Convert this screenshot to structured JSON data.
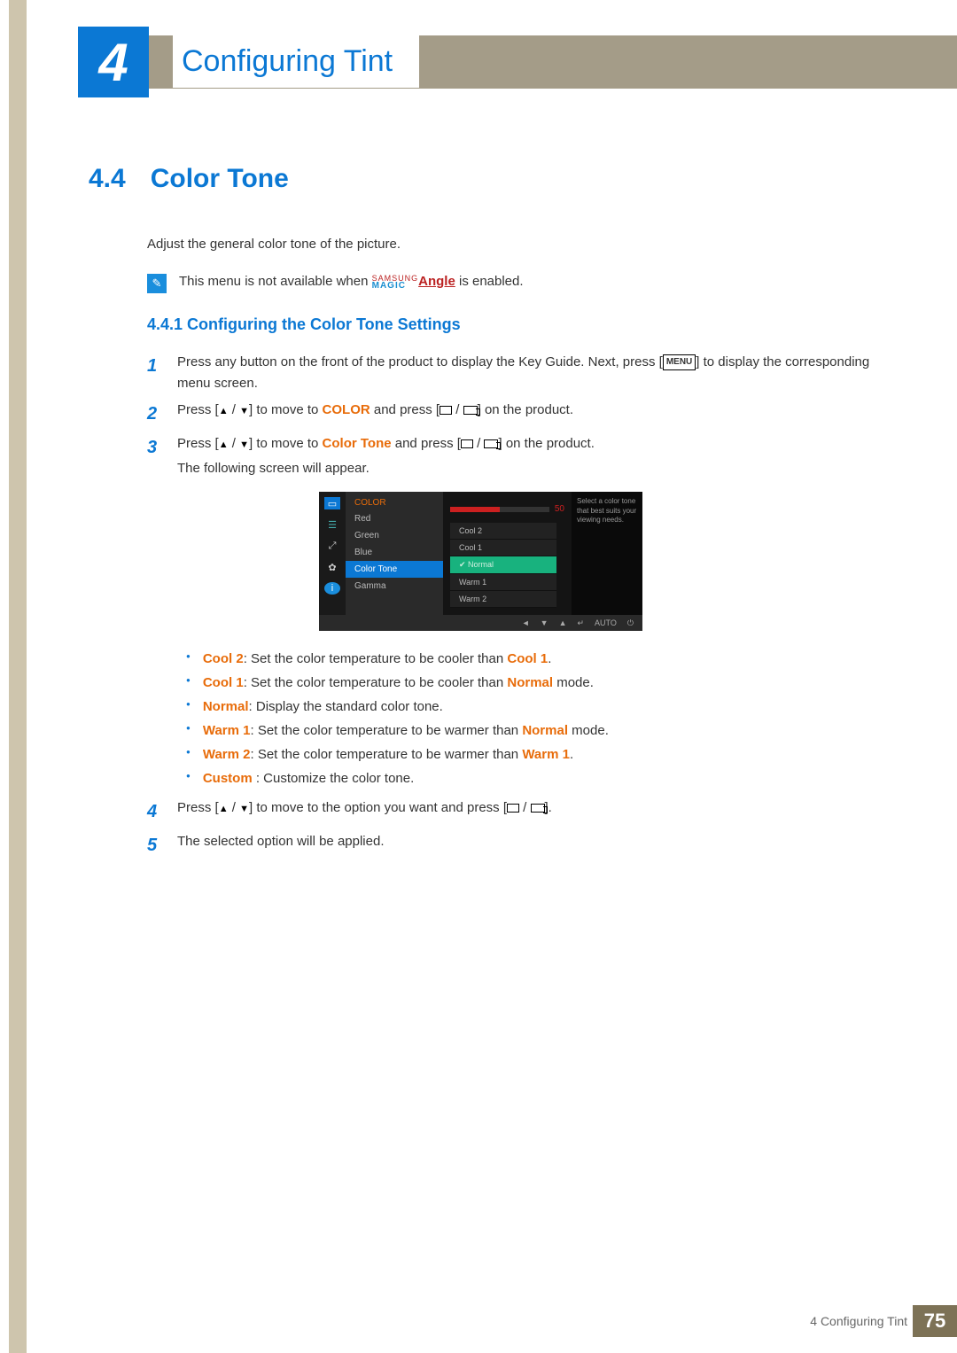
{
  "chapter": {
    "number": "4",
    "title": "Configuring Tint"
  },
  "section": {
    "number": "4.4",
    "title": "Color Tone"
  },
  "intro": "Adjust the general color tone of the picture.",
  "note": {
    "prefix": "This menu is not available when ",
    "brand_top": "SAMSUNG",
    "brand_bot": "MAGIC",
    "brand_word": "Angle",
    "suffix": " is enabled."
  },
  "subsection": "4.4.1   Configuring the Color Tone Settings",
  "steps": {
    "s1": "Press any button on the front of the product to display the Key Guide. Next, press [",
    "s1b": "] to display the corresponding menu screen.",
    "menu_label": "MENU",
    "s2a": "Press [",
    "s2b": "] to move to ",
    "s2c": " and press [",
    "s2d": "] on the product.",
    "color_kw": "COLOR",
    "s3a": "Press [",
    "s3b": "] to move to ",
    "s3c": " and press [",
    "s3d": "] on the product.",
    "ct_kw": "Color Tone",
    "s3e": "The following screen will appear.",
    "s4a": "Press [",
    "s4b": "] to move to the option you want and press [",
    "s4c": "].",
    "s5": "The selected option will be applied."
  },
  "osd": {
    "head": "COLOR",
    "items": [
      "Red",
      "Green",
      "Blue",
      "Color Tone",
      "Gamma"
    ],
    "slider_val": "50",
    "drop": [
      "Cool 2",
      "Cool 1",
      "Normal",
      "Warm 1",
      "Warm 2"
    ],
    "help": "Select a color tone that best suits your viewing needs.",
    "foot_auto": "AUTO"
  },
  "bullets": [
    {
      "k": "Cool 2",
      "t": ": Set the color temperature to be cooler than ",
      "r": "Cool 1",
      "end": "."
    },
    {
      "k": "Cool 1",
      "t": ": Set the color temperature to be cooler than ",
      "r": "Normal",
      "end": " mode."
    },
    {
      "k": "Normal",
      "t": ": Display the standard color tone.",
      "r": "",
      "end": ""
    },
    {
      "k": "Warm 1",
      "t": ": Set the color temperature to be warmer than ",
      "r": "Normal",
      "end": " mode."
    },
    {
      "k": "Warm 2",
      "t": ": Set the color temperature to be warmer than ",
      "r": "Warm 1",
      "end": "."
    },
    {
      "k": "Custom ",
      "t": ": Customize the color tone.",
      "r": "",
      "end": ""
    }
  ],
  "footer": {
    "label": "4 Configuring Tint",
    "page": "75"
  }
}
